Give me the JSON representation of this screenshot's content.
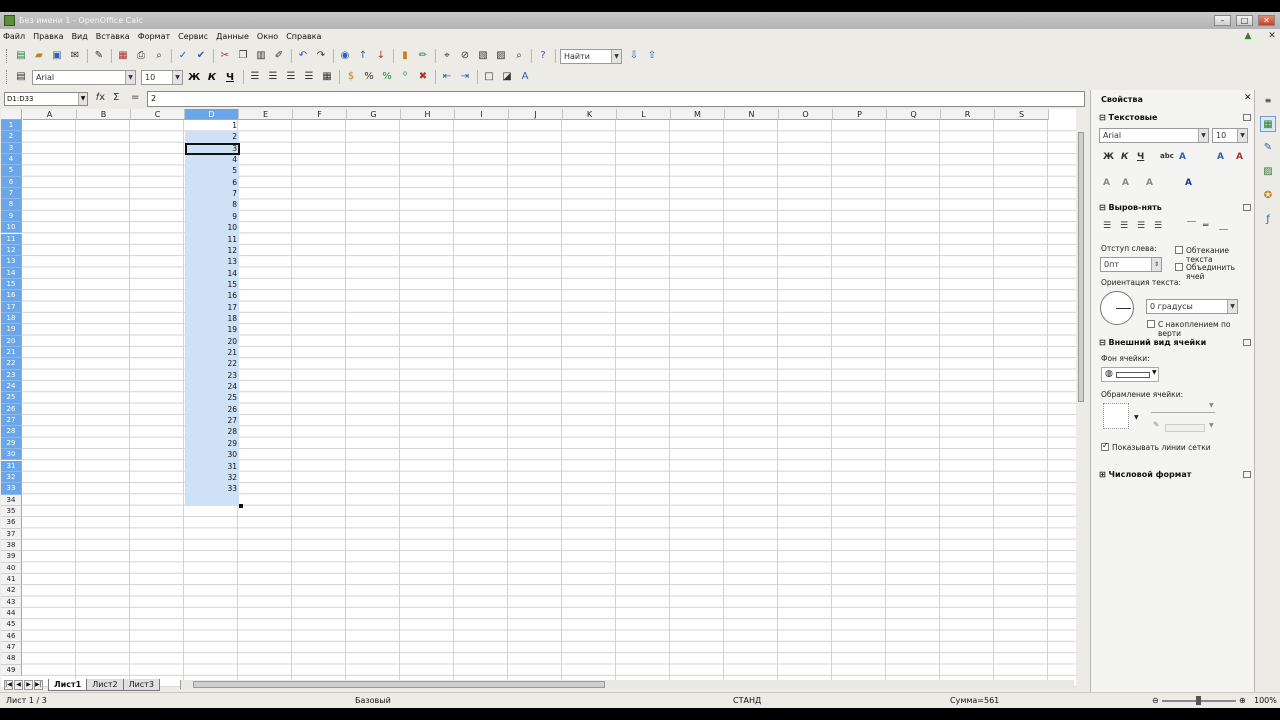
{
  "window": {
    "title": "Без имени 1 - OpenOffice Calc"
  },
  "menu": [
    "Файл",
    "Правка",
    "Вид",
    "Вставка",
    "Формат",
    "Сервис",
    "Данные",
    "Окно",
    "Справка"
  ],
  "toolbar": {
    "find_placeholder": "Найти",
    "font_name": "Arial",
    "font_size": "10",
    "bold": "Ж",
    "italic": "К",
    "underline": "Ч"
  },
  "formula": {
    "name_box": "D1:D33",
    "equals": "=",
    "value": "2"
  },
  "columns": [
    "A",
    "B",
    "C",
    "D",
    "E",
    "F",
    "G",
    "H",
    "I",
    "J",
    "K",
    "L",
    "M",
    "N",
    "O",
    "P",
    "Q",
    "R",
    "S"
  ],
  "selected_column": "D",
  "rows": {
    "first": 1,
    "last": 49,
    "selected_first": 1,
    "selected_last": 33
  },
  "cells_D": [
    1,
    2,
    3,
    4,
    5,
    6,
    7,
    8,
    9,
    10,
    11,
    12,
    13,
    14,
    15,
    16,
    17,
    18,
    19,
    20,
    21,
    22,
    23,
    24,
    25,
    26,
    27,
    28,
    29,
    30,
    31,
    32,
    33
  ],
  "sheets": [
    {
      "label": "Лист1",
      "active": true
    },
    {
      "label": "Лист2",
      "active": false
    },
    {
      "label": "Лист3",
      "active": false
    }
  ],
  "status": {
    "sheet": "Лист 1 / 3",
    "style": "Базовый",
    "mode": "СТАНД",
    "sum": "Сумма=561",
    "zoom": "100%"
  },
  "sidebar": {
    "title": "Свойства",
    "text_section": "Текстовые",
    "font_name": "Arial",
    "font_size": "10",
    "align_section": "Выров-нять",
    "indent_label": "Отступ слева:",
    "indent_value": "0пт",
    "wrap_label": "Обтекание текста",
    "merge_label": "Объединить ячей",
    "orientation_label": "Ориентация текста:",
    "orientation_value": "0 градусы",
    "stacked_label": "С накоплением по верти",
    "cell_section": "Внешний вид ячейки",
    "bg_label": "Фон ячейки:",
    "border_label": "Обрамление ячейки:",
    "gridlines_label": "Показывать линии сетки",
    "number_section": "Числовой формат"
  }
}
